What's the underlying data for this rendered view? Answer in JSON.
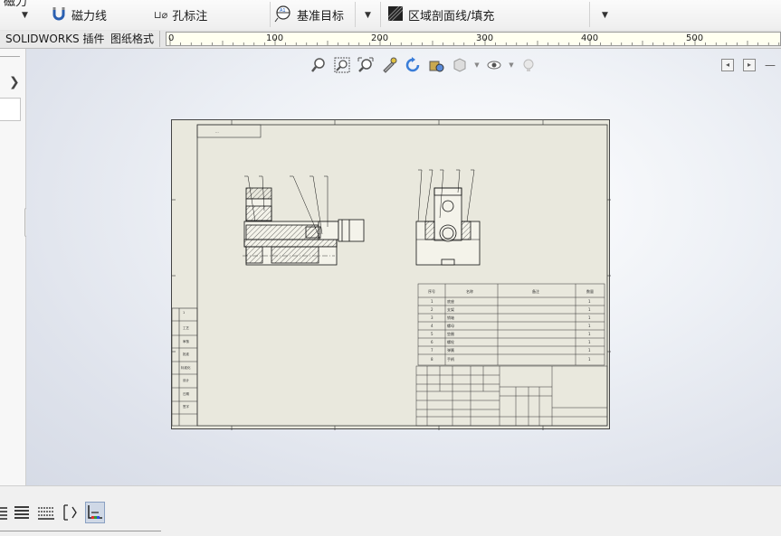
{
  "toolbar": {
    "cut_title": "磁力",
    "magnet_line": "磁力线",
    "hole_callout": "孔标注",
    "datum_target": "基准目标",
    "area_hatch": "区域剖面线/填充"
  },
  "tabs": [
    "SOLIDWORKS 插件",
    "图纸格式"
  ],
  "ruler": {
    "labels": [
      "0",
      "100",
      "200",
      "300",
      "400",
      "500"
    ]
  },
  "hud_icons": [
    "zoom-to-fit-icon",
    "zoom-area-icon",
    "zoom-in-out-icon",
    "pan-icon",
    "rotate-icon",
    "view-settings-icon",
    "display-style-icon",
    "hide-show-icon",
    "appearance-icon"
  ],
  "sheet": {
    "title_block_label": "...",
    "parts_table": {
      "headers": [
        "序号",
        "名称",
        "备注",
        "数量"
      ],
      "rows": [
        [
          "1",
          "底座",
          "",
          "1"
        ],
        [
          "2",
          "支架",
          "",
          "1"
        ],
        [
          "3",
          "销轴",
          "",
          "1"
        ],
        [
          "4",
          "螺母",
          "",
          "1"
        ],
        [
          "5",
          "垫圈",
          "",
          "1"
        ],
        [
          "6",
          "螺栓",
          "",
          "1"
        ],
        [
          "7",
          "弹簧",
          "",
          "1"
        ],
        [
          "8",
          "手柄",
          "",
          "1"
        ]
      ]
    },
    "left_strip": [
      "1",
      "工艺",
      "审核",
      "批准",
      "标准化",
      "设计",
      "日期",
      "签字"
    ]
  },
  "colors": {
    "sheet_bg": "#e9e8dd",
    "line": "#1a1a1a",
    "viewport_bg": "#e3e7ef",
    "accent_blue": "#1f5fbf"
  }
}
